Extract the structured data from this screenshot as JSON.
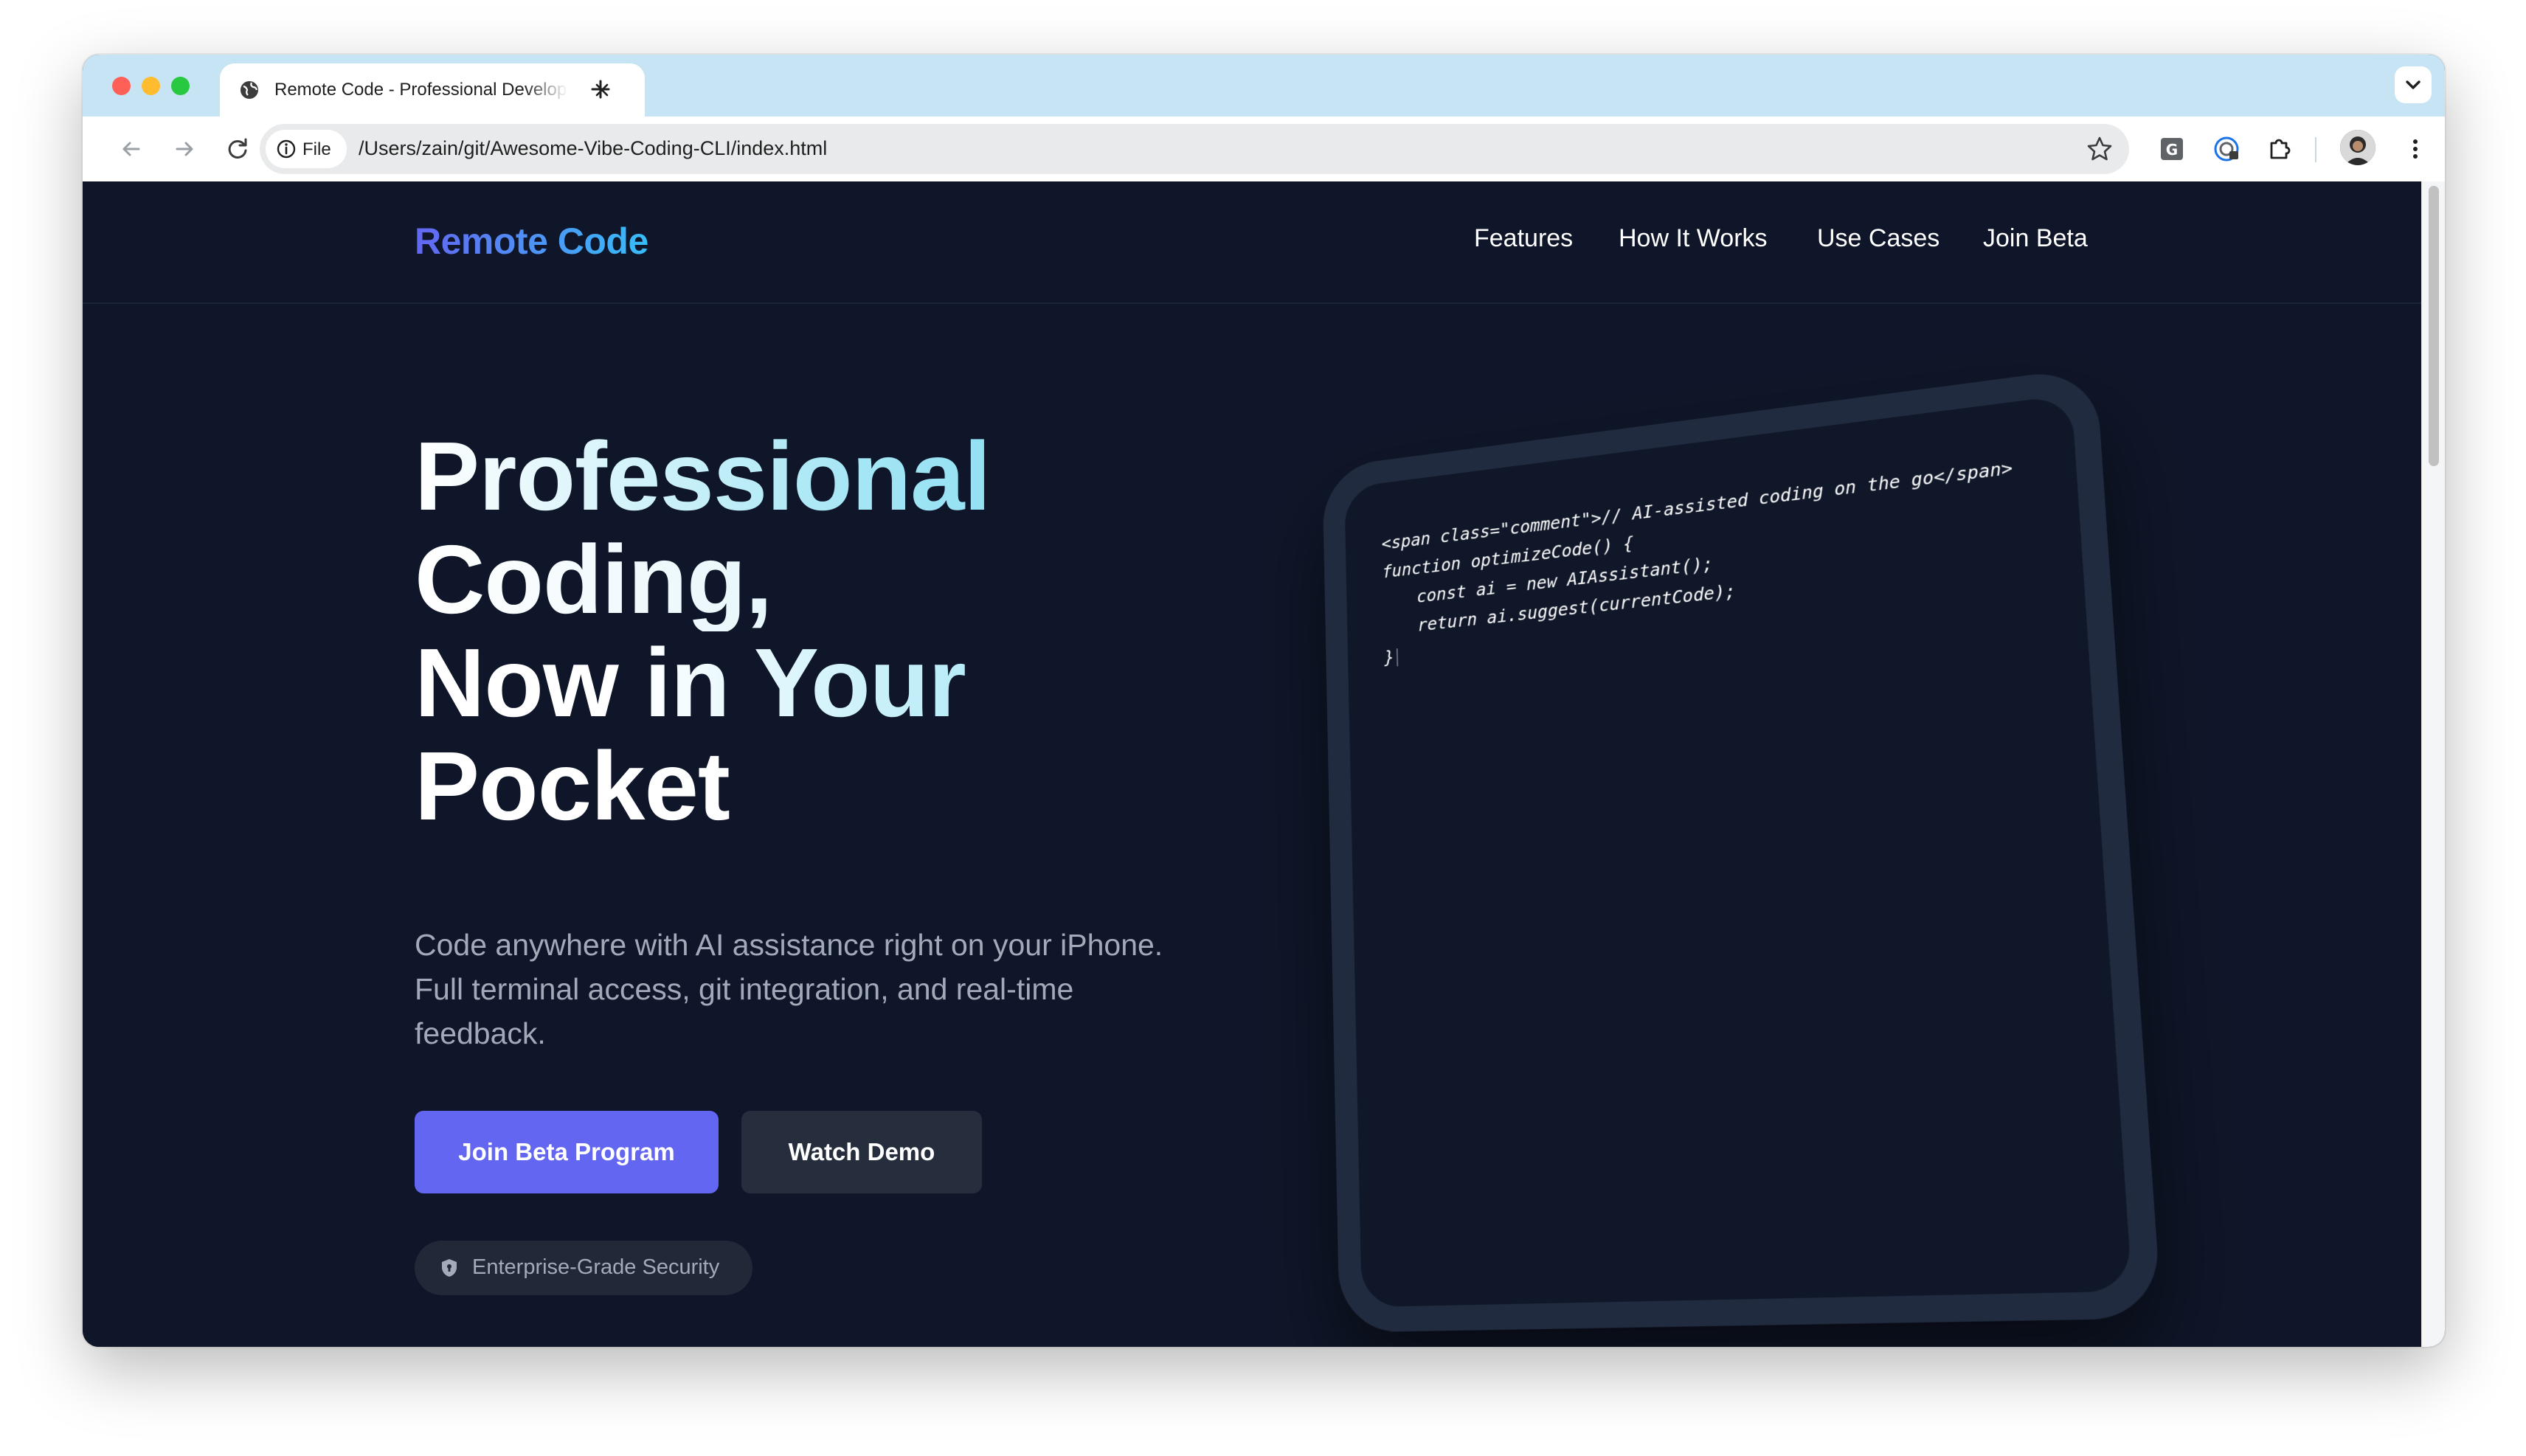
{
  "browser": {
    "tab_title": "Remote Code - Professional Development",
    "chip_label": "File",
    "url": "/Users/zain/git/Awesome-Vibe-Coding-CLI/index.html"
  },
  "site": {
    "brand": "Remote Code",
    "nav": [
      "Features",
      "How It Works",
      "Use Cases",
      "Join Beta"
    ]
  },
  "hero": {
    "title_lines": [
      "Professional",
      "Coding,",
      "Now in Your",
      "Pocket"
    ],
    "subtitle": "Code anywhere with AI assistance right on your iPhone. Full terminal access, git integration, and real-time feedback.",
    "primary_cta": "Join Beta Program",
    "secondary_cta": "Watch Demo",
    "badge": "Enterprise-Grade Security"
  },
  "code_lines": [
    "<span class=\"comment\">// AI-assisted coding on the go</span>",
    "function optimizeCode() {",
    "const ai = new AIAssistant();",
    "return ai.suggest(currentCode);",
    "}"
  ],
  "colors": {
    "page_bg": "#0f1629",
    "accent": "#6366f1",
    "brand_gradient_end": "#38bdf8",
    "tabstrip": "#c6e4f3"
  },
  "icons": [
    "globe-icon",
    "close-icon",
    "plus-icon",
    "chevron-down-icon",
    "back-arrow-icon",
    "forward-arrow-icon",
    "reload-icon",
    "info-icon",
    "star-icon",
    "grammarly-icon",
    "password-extension-icon",
    "puzzle-icon",
    "kebab-menu-icon",
    "shield-icon"
  ]
}
